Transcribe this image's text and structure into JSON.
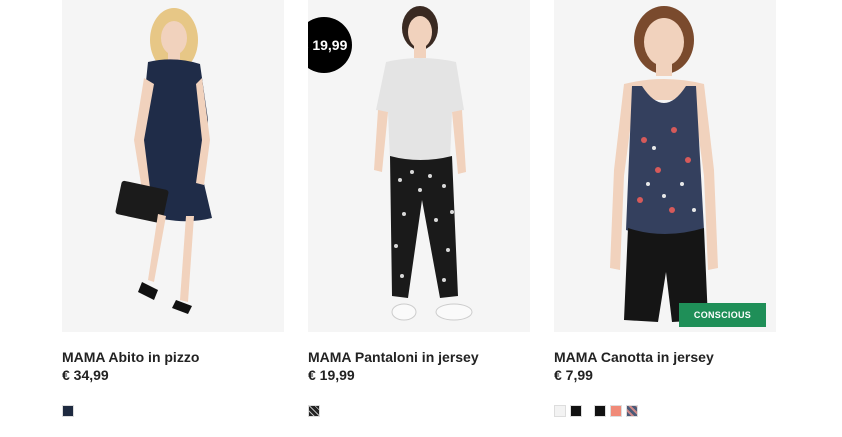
{
  "products": [
    {
      "title": "MAMA Abito in pizzo",
      "price": "€ 34,99",
      "swatches": [
        "#1e2a40"
      ]
    },
    {
      "title": "MAMA Pantaloni in jersey",
      "price": "€ 19,99",
      "price_tag": "€ 19,99",
      "swatches": [
        "#333333"
      ]
    },
    {
      "title": "MAMA Canotta in jersey",
      "price": "€ 7,99",
      "badge": "CONSCIOUS",
      "swatches": [
        "#f3f3f3",
        "#111111",
        "#111111",
        "#f08a78",
        "#5a6a80"
      ]
    }
  ],
  "colors": {
    "badge": "#1f8f58",
    "price_tag": "#000000"
  }
}
